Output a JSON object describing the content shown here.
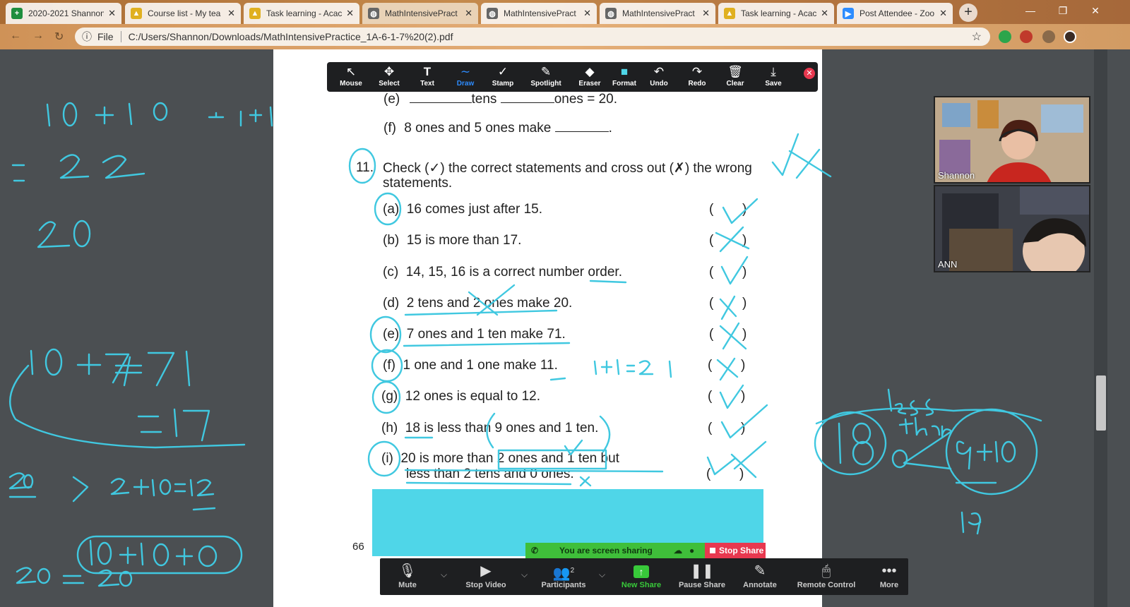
{
  "browser": {
    "tabs": [
      {
        "title": "2020-2021 Shannon",
        "icon": "sheets-icon",
        "color": "#1e8e3e",
        "active": false
      },
      {
        "title": "Course list - My tea",
        "icon": "course-icon",
        "color": "#e0b020",
        "active": false
      },
      {
        "title": "Task learning - Acac",
        "icon": "task-icon",
        "color": "#e0b020",
        "active": false
      },
      {
        "title": "MathIntensivePract",
        "icon": "globe-icon",
        "color": "#666666",
        "active": true
      },
      {
        "title": "MathIntensivePract",
        "icon": "globe-icon",
        "color": "#666666",
        "active": false
      },
      {
        "title": "MathIntensivePract",
        "icon": "globe-icon",
        "color": "#666666",
        "active": false
      },
      {
        "title": "Task learning - Acac",
        "icon": "task-icon",
        "color": "#e0b020",
        "active": false
      },
      {
        "title": "Post Attendee - Zoo",
        "icon": "zoom-icon",
        "color": "#2d8cff",
        "active": false
      }
    ],
    "address": {
      "scheme_label": "File",
      "url": "C:/Users/Shannon/Downloads/MathIntensivePractice_1A-6-1-7%20(2).pdf"
    }
  },
  "annotation_toolbar": {
    "buttons": [
      {
        "label": "Mouse",
        "icon": "↖"
      },
      {
        "label": "Select",
        "icon": "✥"
      },
      {
        "label": "Text",
        "icon": "T"
      },
      {
        "label": "Draw",
        "icon": "∼"
      },
      {
        "label": "Stamp",
        "icon": "✓"
      },
      {
        "label": "Spotlight",
        "icon": "✎"
      },
      {
        "label": "Eraser",
        "icon": "◆"
      },
      {
        "label": "Format",
        "icon": "■"
      },
      {
        "label": "Undo",
        "icon": "↶"
      },
      {
        "label": "Redo",
        "icon": "↷"
      },
      {
        "label": "Clear",
        "icon": "🗑"
      },
      {
        "label": "Save",
        "icon": "⤓"
      }
    ],
    "active": "Draw",
    "format_color": "#4fd6e8"
  },
  "worksheet": {
    "line_e_top": {
      "label": "(e)",
      "text1": "tens",
      "text2": "ones = 20."
    },
    "line_f_top": {
      "label": "(f)",
      "text": "8 ones and 5 ones make",
      "end": "."
    },
    "question": {
      "number": "11.",
      "line1": "Check (✓) the correct statements and cross out (✗) the wrong",
      "line2": "statements."
    },
    "items": [
      {
        "label": "(a)",
        "text": "16 comes just after 15."
      },
      {
        "label": "(b)",
        "text": "15 is more than 17."
      },
      {
        "label": "(c)",
        "text": "14, 15, 16 is a correct number order."
      },
      {
        "label": "(d)",
        "text": "2 tens and 2 ones make 20."
      },
      {
        "label": "(e)",
        "text": "7 ones and 1 ten make 71."
      },
      {
        "label": "(f)",
        "text": "1 one and 1 one make 11."
      },
      {
        "label": "(g)",
        "text": "12 ones is equal to 12."
      },
      {
        "label": "(h)",
        "text": "18 is less than 9 ones and 1 ten."
      },
      {
        "label": "(i)",
        "text": "20 is more than 2 ones and 1 ten but"
      }
    ],
    "item_i_line2": "less than 2 tens and 0 ones.",
    "paren_open": "(",
    "paren_close": ")",
    "page_number": "66"
  },
  "video": {
    "participants": [
      {
        "name": "Shannon"
      },
      {
        "name": "ANN"
      }
    ]
  },
  "share_bar": {
    "status": "You are screen sharing",
    "stop_label": "Stop Share"
  },
  "zoom_toolbar": {
    "buttons": [
      {
        "label": "Mute",
        "icon": "🎙"
      },
      {
        "label": "Stop Video",
        "icon": "▶"
      },
      {
        "label": "Participants",
        "icon": "👥",
        "badge": "2"
      },
      {
        "label": "New Share",
        "icon": "↑"
      },
      {
        "label": "Pause Share",
        "icon": "❚❚"
      },
      {
        "label": "Annotate",
        "icon": "✎"
      },
      {
        "label": "Remote Control",
        "icon": "🖱"
      },
      {
        "label": "More",
        "icon": "•••"
      }
    ]
  },
  "colors": {
    "ink": "#40c8e0",
    "zoom_blue": "#2d8cff",
    "stop_red": "#e8384f",
    "share_green": "#3fbf3a"
  }
}
